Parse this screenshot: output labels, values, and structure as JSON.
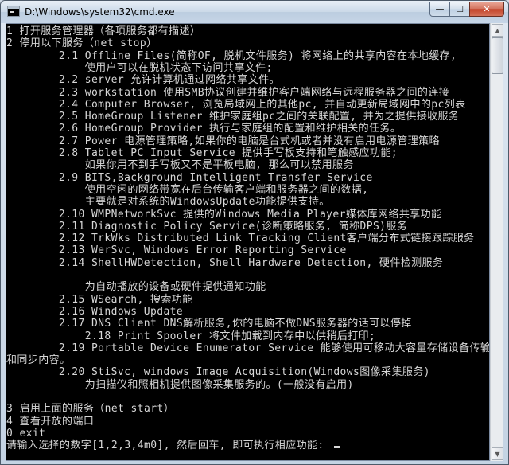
{
  "window": {
    "title": "D:\\Windows\\system32\\cmd.exe",
    "icon": "console-icon",
    "buttons": {
      "minimize": "—",
      "maximize": "☐",
      "close": "✕"
    }
  },
  "console": {
    "lines": [
      "1 打开服务管理器（各项服务都有描述）",
      "2 停用以下服务（net stop）",
      "        2.1 Offline Files(简称OF, 脱机文件服务) 将网络上的共享内容在本地缓存,",
      "            使用户可以在脱机状态下访问共享文件;",
      "        2.2 server 允许计算机通过网络共享文件。",
      "        2.3 workstation 使用SMB协议创建并维护客户端网络与远程服务器之间的连接",
      "        2.4 Computer Browser, 浏览局域网上的其他pc, 并自动更新局域网中的pc列表",
      "        2.5 HomeGroup Listener 维护家庭组pc之间的关联配置, 并为之提供接收服务",
      "        2.6 HomeGroup Provider 执行与家庭组的配置和维护相关的任务。",
      "        2.7 Power 电源管理策略,如果你的电脑是台式机或者并没有启用电源管理策略",
      "        2.8 Tablet PC Input Service 提供手写板支持和笔触感应功能;",
      "            如果你用不到手写板又不是平板电脑, 那么可以禁用服务",
      "        2.9 BITS,Background Intelligent Transfer Service",
      "            使用空闲的网络带宽在后台传输客户端和服务器之间的数据,",
      "            主要就是对系统的WindowsUpdate功能提供支持。",
      "        2.10 WMPNetworkSvc 提供的Windows Media Player媒体库网络共享功能",
      "        2.11 Diagnostic Policy Service(诊断策略服务, 简称DPS)服务",
      "        2.12 TrkWks Distributed Link Tracking Client客户端分布式链接跟踪服务",
      "        2.13 WerSvc, Windows Error Reporting Service",
      "        2.14 ShellHWDetection, Shell Hardware Detection, 硬件检测服务",
      "",
      "            为自动播放的设备或硬件提供通知功能",
      "        2.15 WSearch, 搜索功能",
      "        2.16 Windows Update",
      "        2.17 DNS Client DNS解析服务,你的电脑不做DNS服务器的话可以停掉",
      "            2.18 Print Spooler 将文件加载到内存中以供稍后打印;",
      "        2.19 Portable Device Enumerator Service 能够使用可移动大容量存储设备传输",
      "和同步内容。",
      "        2.20 StiSvc, windows Image Acquisition(Windows图像采集服务)",
      "            为扫描仪和照相机提供图像采集服务的。(一般没有启用)",
      "",
      "3 启用上面的服务（net start）",
      "4 查看开放的端口",
      "0 exit",
      "请输入选择的数字[1,2,3,4m0], 然后回车, 即可执行相应功能: "
    ]
  }
}
